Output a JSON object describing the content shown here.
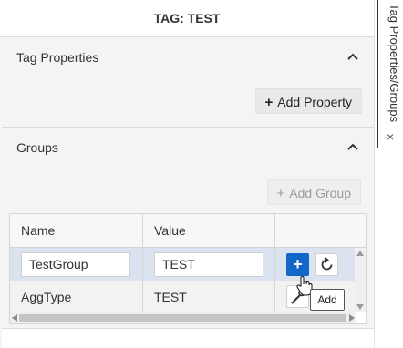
{
  "panel": {
    "title": "TAG: TEST",
    "tag_properties": {
      "header": "Tag Properties",
      "add_button": "Add Property"
    },
    "groups": {
      "header": "Groups",
      "add_button": "Add Group",
      "columns": [
        "Name",
        "Value"
      ],
      "rows": [
        {
          "name": "TestGroup",
          "value": "TEST"
        },
        {
          "name": "AggType",
          "value": "TEST"
        }
      ]
    }
  },
  "tooltip": "Add",
  "side_tab": {
    "label": "Tag Properties/Groups",
    "close": "×"
  },
  "colors": {
    "accent": "#1166c8",
    "selected_row": "#dbe3f1"
  },
  "icons": {
    "add": "plus-icon",
    "reset": "refresh-icon",
    "edit": "wrench-icon",
    "collapse": "chevron-up-icon"
  }
}
